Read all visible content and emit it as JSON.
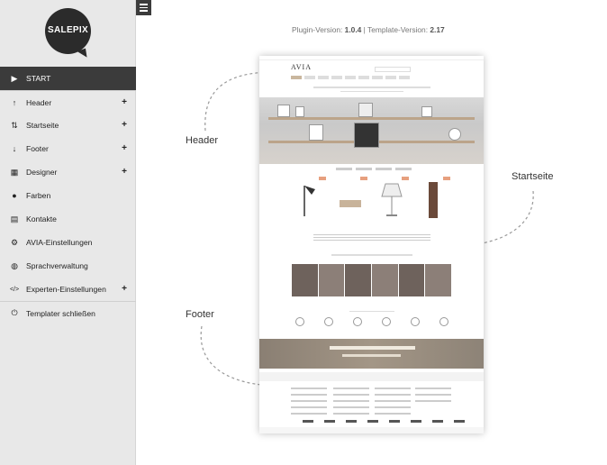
{
  "sidebar": {
    "logo_text": "SALEPIX",
    "items": [
      {
        "label": "START",
        "icon": "play-icon",
        "glyph": "▶",
        "expandable": false,
        "active": true
      },
      {
        "label": "Header",
        "icon": "arrow-up-icon",
        "glyph": "↑",
        "expandable": true,
        "active": false
      },
      {
        "label": "Startseite",
        "icon": "arrows-vertical-icon",
        "glyph": "⇅",
        "expandable": true,
        "active": false
      },
      {
        "label": "Footer",
        "icon": "arrow-down-icon",
        "glyph": "↓",
        "expandable": true,
        "active": false
      },
      {
        "label": "Designer",
        "icon": "grid-icon",
        "glyph": "▦",
        "expandable": true,
        "active": false
      },
      {
        "label": "Farben",
        "icon": "drop-icon",
        "glyph": "●",
        "expandable": false,
        "active": false
      },
      {
        "label": "Kontakte",
        "icon": "contact-card-icon",
        "glyph": "▤",
        "expandable": false,
        "active": false
      },
      {
        "label": "AVIA-Einstellungen",
        "icon": "gear-icon",
        "glyph": "⚙",
        "expandable": false,
        "active": false
      },
      {
        "label": "Sprachverwaltung",
        "icon": "globe-icon",
        "glyph": "◍",
        "expandable": false,
        "active": false
      },
      {
        "label": "Experten-Einstellungen",
        "icon": "code-icon",
        "glyph": "</>",
        "expandable": true,
        "active": false
      },
      {
        "label": "Templater schließen",
        "icon": "power-icon",
        "glyph": "⏻",
        "expandable": false,
        "active": false
      }
    ],
    "expand_symbol": "+"
  },
  "menu_toggle_icon": "hamburger-icon",
  "version": {
    "plugin_label": "Plugin-Version:",
    "plugin_value": "1.0.4",
    "separator": "|",
    "template_label": "Template-Version:",
    "template_value": "2.17"
  },
  "annotations": {
    "header": "Header",
    "startseite": "Startseite",
    "footer": "Footer"
  },
  "preview": {
    "logo": "AVIA"
  }
}
